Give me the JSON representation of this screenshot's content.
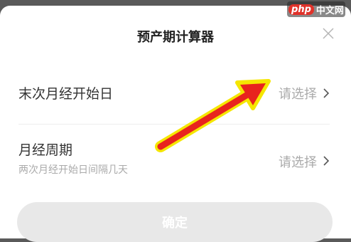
{
  "dialog": {
    "title": "预产期计算器"
  },
  "rows": [
    {
      "label": "末次月经开始日",
      "value": "请选择"
    },
    {
      "label": "月经周期",
      "sublabel": "两次月经开始日间隔几天",
      "value": "请选择"
    }
  ],
  "footer": {
    "confirm_label": "确定"
  },
  "watermark": {
    "logo": "php",
    "text": "中文网"
  },
  "colors": {
    "annotation_arrow": "#e8231e",
    "annotation_outline": "#f5e600",
    "confirm_bg": "#e8e8e8",
    "placeholder": "#aaaaaa"
  },
  "icons": {
    "close": "close-icon",
    "chevron": "chevron-right-icon"
  }
}
